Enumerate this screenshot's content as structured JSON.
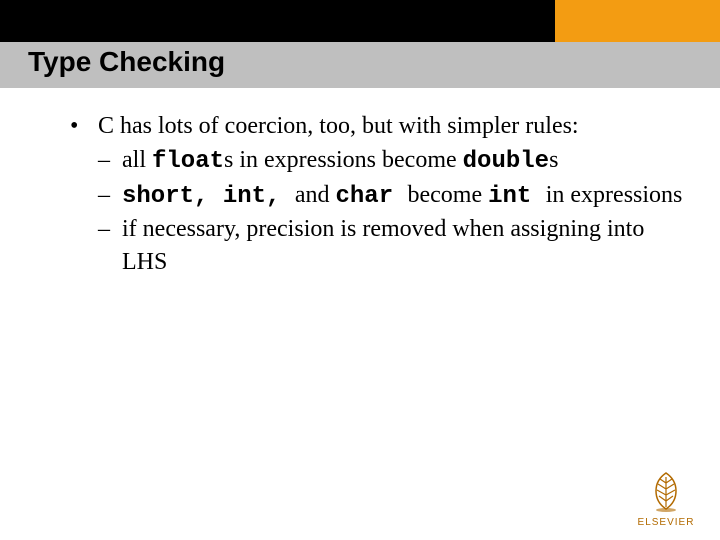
{
  "title": "Type Checking",
  "bullet": {
    "marker": "•",
    "text": "C has lots of coercion, too, but with simpler rules:"
  },
  "subs": [
    {
      "marker": "–",
      "parts": [
        {
          "t": "all ",
          "mono": false
        },
        {
          "t": "float",
          "mono": true
        },
        {
          "t": "s in expressions become ",
          "mono": false
        },
        {
          "t": "double",
          "mono": true
        },
        {
          "t": "s",
          "mono": false
        }
      ]
    },
    {
      "marker": "–",
      "parts": [
        {
          "t": "short, int, ",
          "mono": true
        },
        {
          "t": "and ",
          "mono": false
        },
        {
          "t": "char ",
          "mono": true
        },
        {
          "t": "become ",
          "mono": false
        },
        {
          "t": "int ",
          "mono": true
        },
        {
          "t": "in expressions",
          "mono": false
        }
      ]
    },
    {
      "marker": "–",
      "parts": [
        {
          "t": "if necessary, precision is removed when assigning into LHS",
          "mono": false
        }
      ]
    }
  ],
  "logo": {
    "text": "ELSEVIER"
  }
}
